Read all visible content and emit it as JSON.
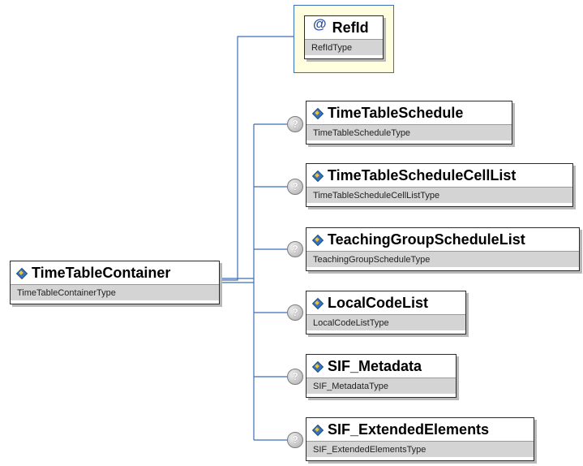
{
  "diagram": {
    "root": {
      "name": "TimeTableContainer",
      "type": "TimeTableContainerType"
    },
    "attribute": {
      "icon": "@",
      "name": "RefId",
      "type": "RefIdType"
    },
    "children": [
      {
        "name": "TimeTableSchedule",
        "type": "TimeTableScheduleType",
        "optional_icon": "?"
      },
      {
        "name": "TimeTableScheduleCellList",
        "type": "TimeTableScheduleCellListType",
        "optional_icon": "?"
      },
      {
        "name": "TeachingGroupScheduleList",
        "type": "TeachingGroupScheduleType",
        "optional_icon": "?"
      },
      {
        "name": "LocalCodeList",
        "type": "LocalCodeListType",
        "optional_icon": "?"
      },
      {
        "name": "SIF_Metadata",
        "type": "SIF_MetadataType",
        "optional_icon": "?"
      },
      {
        "name": "SIF_ExtendedElements",
        "type": "SIF_ExtendedElementsType",
        "optional_icon": "?"
      }
    ],
    "colors": {
      "connector": "#3b6fb6",
      "attribute_background": "#ffffe0",
      "type_strip": "#d4d4d4",
      "element_icon": "#3a73b8"
    }
  }
}
